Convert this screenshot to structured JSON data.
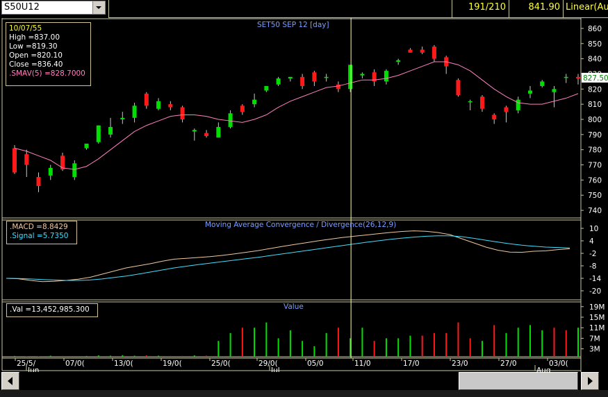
{
  "toolbar": {
    "symbol": "S50U12",
    "count": "191/210",
    "price": "841.90",
    "scale_mode": "Linear(Aut"
  },
  "price_panel": {
    "title": "SET50 SEP 12    [day]",
    "info": {
      "date": "10/07/55",
      "high": "High   =837.00",
      "low": "Low    =819.30",
      "open": "Open   =820.10",
      "close": "Close  =836.40",
      "smav": ".SMAV(5)   =828.7000"
    },
    "y_ticks": [
      "860",
      "850",
      "840",
      "830",
      "820",
      "810",
      "800",
      "790",
      "780",
      "770",
      "760",
      "750",
      "740"
    ],
    "last_marker": "827.50",
    "up_color": "#00e000",
    "down_color": "#ff1a1a",
    "sma_color": "#ff80c0"
  },
  "macd_panel": {
    "title": "Moving Average Convergence / Divergence(26,12,9)",
    "macd_label": ".MACD   =8.8429",
    "signal_label": ".Signal    =5.7350",
    "y_ticks": [
      "10",
      "4",
      "-2",
      "-8",
      "-14",
      "-20"
    ],
    "macd_color": "#f2c9a0",
    "signal_color": "#40e0ff"
  },
  "volume_panel": {
    "title": "Value",
    "val_label": ".Val   =13,452,985.300",
    "y_ticks": [
      "19M",
      "15M",
      "11M",
      "7M",
      "3M"
    ]
  },
  "x_axis": {
    "ticks": [
      "25/5/",
      "07/0(",
      "13/0(",
      "19/0(",
      "25/0(",
      "29/0(",
      "05/0",
      "11/0",
      "17/0",
      "23/0",
      "27/0",
      "03/0("
    ],
    "months": [
      "Jun",
      "Jul",
      "Aug"
    ]
  },
  "chart_data": [
    {
      "type": "candlestick",
      "title": "SET50 SEP 12    [day]",
      "ylim": [
        735,
        865
      ],
      "dates_shown": [
        "25/5/",
        "07/0(",
        "13/0(",
        "19/0(",
        "25/0(",
        "29/0(",
        "05/0",
        "11/0",
        "17/0",
        "23/0",
        "27/0",
        "03/0("
      ],
      "ohlc": [
        [
          781,
          783,
          764,
          765
        ],
        [
          777,
          780,
          762,
          770
        ],
        [
          762,
          765,
          752,
          756
        ],
        [
          763,
          770,
          760,
          768
        ],
        [
          776,
          778,
          766,
          767
        ],
        [
          762,
          773,
          760,
          771
        ],
        [
          781,
          784,
          780,
          784
        ],
        [
          785,
          796,
          784,
          796
        ],
        [
          790,
          801,
          788,
          795
        ],
        [
          800,
          805,
          797,
          801
        ],
        [
          801,
          811,
          798,
          809
        ],
        [
          817,
          818,
          807,
          809
        ],
        [
          807,
          814,
          806,
          812
        ],
        [
          810,
          812,
          806,
          808
        ],
        [
          808,
          809,
          798,
          800
        ],
        [
          792,
          794,
          786,
          793
        ],
        [
          791,
          793,
          788,
          789
        ],
        [
          788,
          798,
          788,
          795
        ],
        [
          795,
          806,
          794,
          804
        ],
        [
          809,
          810,
          803,
          805
        ],
        [
          810,
          817,
          808,
          813
        ],
        [
          819,
          822,
          818,
          822
        ],
        [
          823,
          828,
          822,
          827
        ],
        [
          827,
          828,
          825,
          828
        ],
        [
          828,
          830,
          820,
          822
        ],
        [
          831,
          832,
          822,
          825
        ],
        [
          828,
          830,
          825,
          828
        ],
        [
          823,
          825,
          818,
          820
        ],
        [
          820,
          836,
          818,
          836
        ],
        [
          829,
          831,
          827,
          830
        ],
        [
          831,
          833,
          822,
          825
        ],
        [
          825,
          833,
          823,
          832
        ],
        [
          838,
          840,
          836,
          839
        ],
        [
          846,
          847,
          844,
          844
        ],
        [
          846,
          848,
          843,
          844
        ],
        [
          848,
          849,
          838,
          840
        ],
        [
          841,
          842,
          830,
          835
        ],
        [
          826,
          827,
          815,
          816
        ],
        [
          812,
          813,
          806,
          812
        ],
        [
          815,
          816,
          805,
          807
        ],
        [
          803,
          804,
          797,
          800
        ],
        [
          808,
          809,
          798,
          805
        ],
        [
          806,
          815,
          804,
          813
        ],
        [
          817,
          822,
          814,
          819
        ],
        [
          822,
          826,
          821,
          825
        ],
        [
          818,
          822,
          808,
          820
        ],
        [
          828,
          830,
          824,
          828
        ],
        [
          828,
          830,
          823,
          827
        ]
      ],
      "sma5": [
        781,
        779,
        776,
        773,
        768,
        767,
        769,
        774,
        780,
        786,
        792,
        796,
        799,
        802,
        803,
        803,
        802,
        800,
        799,
        798,
        800,
        803,
        808,
        812,
        815,
        818,
        821,
        822,
        824,
        826,
        826,
        827,
        829,
        832,
        835,
        838,
        838,
        836,
        832,
        826,
        820,
        815,
        811,
        810,
        810,
        812,
        814,
        817,
        820,
        824
      ]
    },
    {
      "type": "line",
      "title": "Moving Average Convergence / Divergence(26,12,9)",
      "ylim": [
        -23,
        13
      ],
      "series": [
        {
          "name": ".MACD",
          "values": [
            -14,
            -14.2,
            -15,
            -15.6,
            -15.4,
            -15,
            -14.4,
            -13.5,
            -12,
            -10.5,
            -9,
            -8,
            -7,
            -5.8,
            -4.8,
            -4.4,
            -4,
            -3.6,
            -3,
            -2.3,
            -1.5,
            -0.7,
            0.3,
            1.3,
            2.2,
            3.1,
            4,
            4.8,
            5.6,
            6.2,
            6.8,
            7.4,
            8,
            8.5,
            8.8,
            8.6,
            8,
            7,
            5,
            3,
            1,
            -0.5,
            -1.4,
            -1.5,
            -1,
            -0.8,
            -0.2,
            0.2
          ]
        },
        {
          "name": ".Signal",
          "values": [
            -14,
            -14.1,
            -14.3,
            -14.6,
            -14.8,
            -15,
            -15,
            -14.8,
            -14.3,
            -13.6,
            -12.9,
            -12,
            -11,
            -10,
            -9,
            -8.2,
            -7.4,
            -6.7,
            -6,
            -5.3,
            -4.6,
            -3.9,
            -3.1,
            -2.3,
            -1.5,
            -0.7,
            0.1,
            0.9,
            1.7,
            2.5,
            3.3,
            4,
            4.7,
            5.3,
            5.8,
            6.2,
            6.4,
            6.4,
            6,
            5.2,
            4.3,
            3.4,
            2.6,
            1.9,
            1.4,
            1,
            0.8,
            0.6
          ]
        }
      ]
    },
    {
      "type": "bar",
      "title": "Value",
      "ylim": [
        0,
        20
      ],
      "values": [
        0.3,
        0.2,
        0.1,
        0.4,
        0.3,
        0.2,
        0.3,
        0.5,
        0.4,
        0.6,
        0.4,
        0.5,
        0.4,
        0.3,
        0.3,
        0.5,
        0.4,
        6,
        9,
        11,
        11,
        13,
        7,
        10,
        6,
        4,
        9,
        11,
        7,
        11,
        6,
        7,
        7,
        8,
        8,
        9,
        9,
        13,
        7,
        6,
        12,
        9,
        11,
        12,
        10,
        11,
        10,
        11
      ],
      "up": [
        1,
        0,
        0,
        1,
        0,
        1,
        1,
        1,
        1,
        1,
        1,
        0,
        1,
        0,
        0,
        1,
        0,
        1,
        1,
        0,
        1,
        1,
        1,
        1,
        1,
        1,
        1,
        0,
        1,
        1,
        0,
        1,
        1,
        1,
        0,
        0,
        0,
        0,
        0,
        1,
        0,
        1,
        1,
        1,
        1,
        0,
        0,
        1
      ]
    }
  ]
}
